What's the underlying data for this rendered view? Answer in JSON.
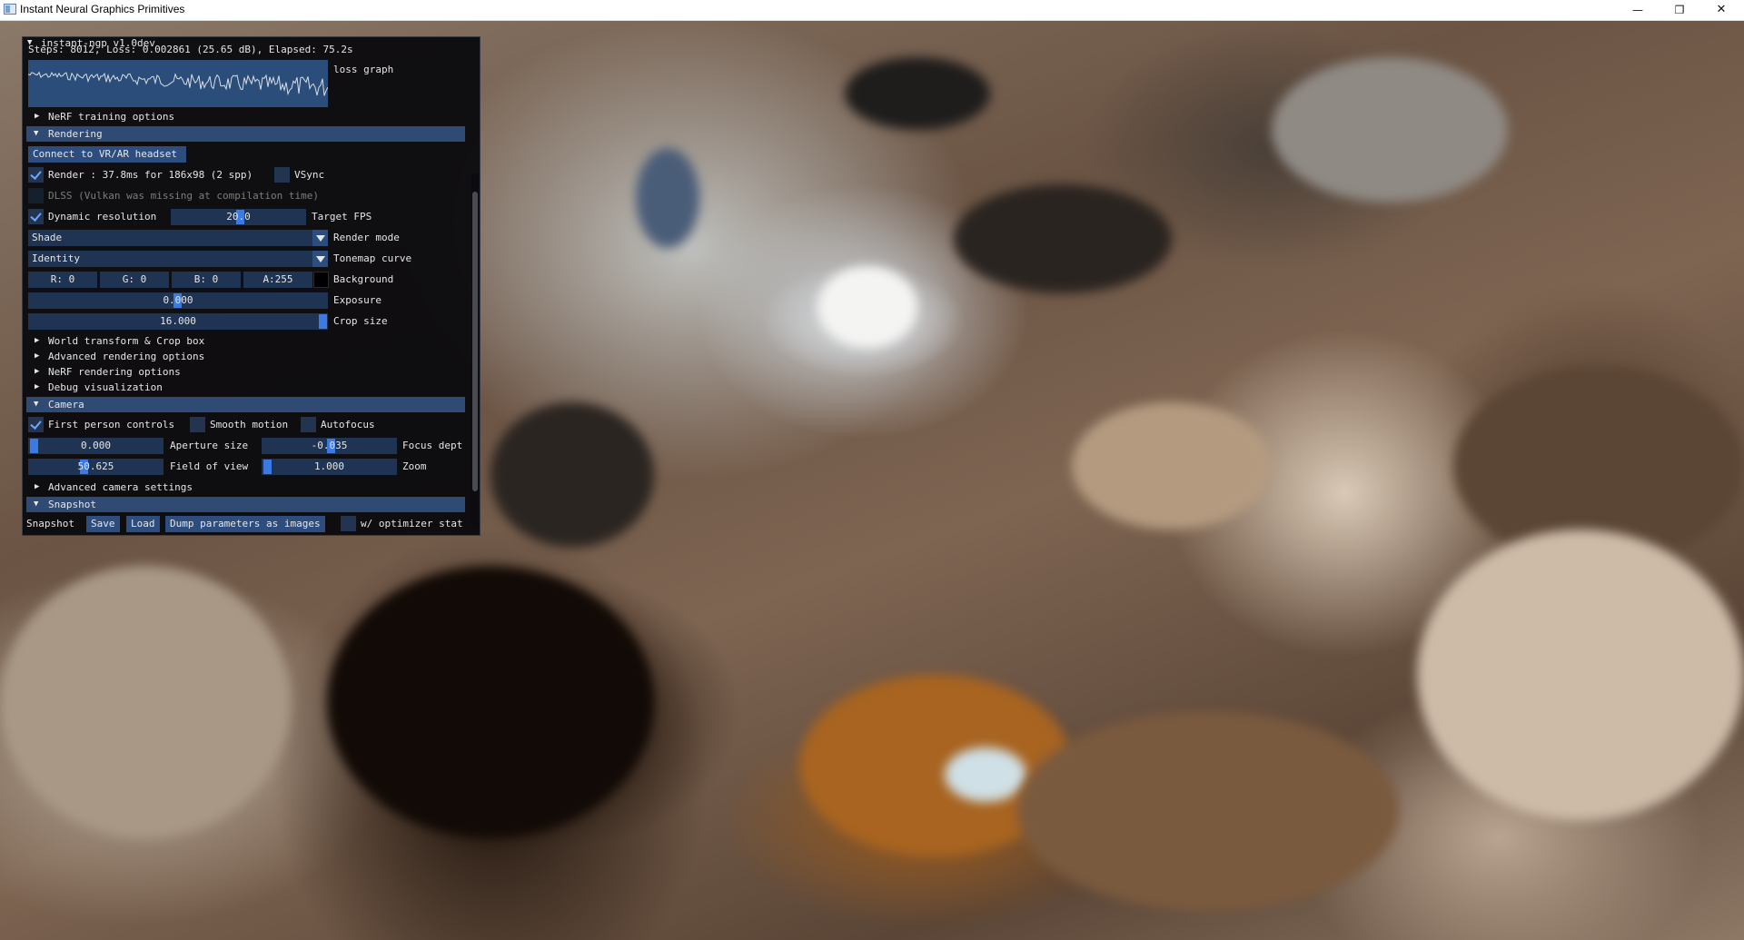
{
  "window": {
    "title": "Instant Neural Graphics Primitives",
    "minimize_glyph": "—",
    "maximize_glyph": "❐",
    "close_glyph": "✕"
  },
  "panel": {
    "title": "instant-ngp v1.0dev",
    "status_line": "Steps: 8012, Loss: 0.002861 (25.65 dB), Elapsed: 75.2s",
    "loss_graph_label": "loss graph",
    "nerf_training_options": "NeRF training options",
    "rendering": {
      "header": "Rendering",
      "vr_button": "Connect to VR/AR headset",
      "render_label": "Render : 37.8ms for 186x98 (2 spp)",
      "render_checked": true,
      "vsync_label": "VSync",
      "vsync_checked": false,
      "dlss_label": "DLSS (Vulkan was missing at compilation time)",
      "dynamic_res_label": "Dynamic resolution",
      "dynamic_res_checked": true,
      "target_fps_value": "20.0",
      "target_fps_label": "Target FPS",
      "render_mode_value": "Shade",
      "render_mode_label": "Render mode",
      "tonemap_value": "Identity",
      "tonemap_label": "Tonemap curve",
      "bg_r": "R:  0",
      "bg_g": "G:  0",
      "bg_b": "B:  0",
      "bg_a": "A:255",
      "background_label": "Background",
      "background_color": "#000000",
      "exposure_value": "0.000",
      "exposure_label": "Exposure",
      "crop_value": "16.000",
      "crop_label": "Crop size",
      "sections": [
        "World transform & Crop box",
        "Advanced rendering options",
        "NeRF rendering options",
        "Debug visualization"
      ]
    },
    "camera": {
      "header": "Camera",
      "first_person_label": "First person controls",
      "first_person_checked": true,
      "smooth_motion_label": "Smooth motion",
      "autofocus_label": "Autofocus",
      "aperture_value": "0.000",
      "aperture_label": "Aperture size",
      "focus_value": "-0.035",
      "focus_label": "Focus dept",
      "fov_value": "50.625",
      "fov_label": "Field of view",
      "zoom_value": "1.000",
      "zoom_label": "Zoom",
      "advanced_label": "Advanced camera settings"
    },
    "snapshot": {
      "header": "Snapshot",
      "label": "Snapshot",
      "save": "Save",
      "load": "Load",
      "dump": "Dump parameters as images",
      "optimizer_label": "w/ optimizer stat"
    }
  },
  "colors": {
    "header_bg": "#2f4a73",
    "button_bg": "#2d4d7e",
    "field_bg": "#1f3352",
    "accent": "#3d7ae0"
  }
}
